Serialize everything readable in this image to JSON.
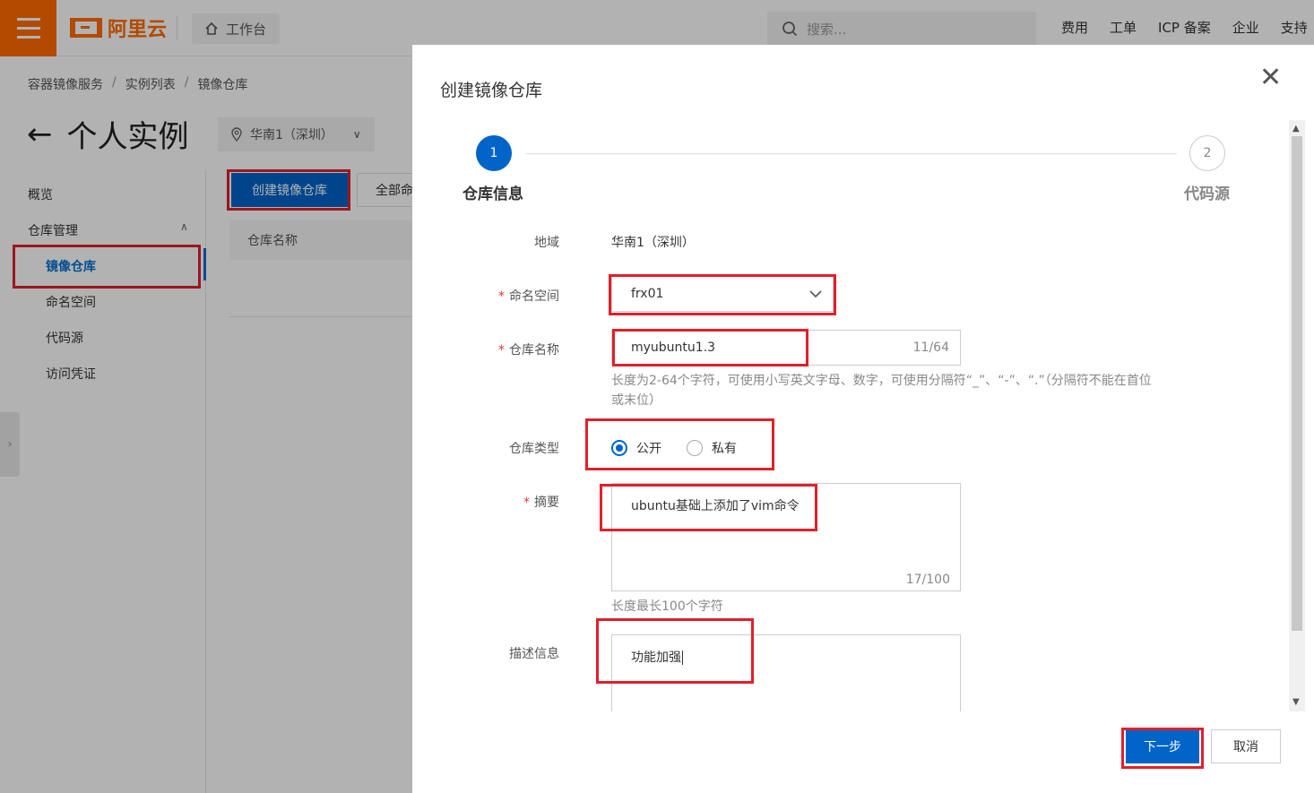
{
  "topbar": {
    "logo_text": "阿里云",
    "workbench_label": "工作台",
    "search_placeholder": "搜索...",
    "nav": [
      "费用",
      "工单",
      "ICP 备案",
      "企业",
      "支持"
    ]
  },
  "breadcrumb": [
    "容器镜像服务",
    "实例列表",
    "镜像仓库"
  ],
  "page": {
    "title": "个人实例",
    "region": "华南1（深圳）"
  },
  "sidebar": {
    "overview": "概览",
    "repo_manage": "仓库管理",
    "items": [
      "镜像仓库",
      "命名空间",
      "代码源",
      "访问凭证"
    ]
  },
  "main": {
    "create_button": "创建镜像仓库",
    "all_button": "全部命",
    "table_header": "仓库名称"
  },
  "dialog": {
    "title": "创建镜像仓库",
    "steps": [
      {
        "num": "1",
        "label": "仓库信息"
      },
      {
        "num": "2",
        "label": "代码源"
      }
    ],
    "region_label": "地域",
    "region_value": "华南1（深圳）",
    "namespace_label": "命名空间",
    "namespace_value": "frx01",
    "repo_name_label": "仓库名称",
    "repo_name_value": "myubuntu1.3",
    "repo_name_count": "11/64",
    "repo_name_hint_1": "长度为2-64个字符，可使用小写英文字母、数字，可使用分隔符“_”、“-”、“.”（分隔符不能在首位",
    "repo_name_hint_2": "或末位）",
    "repo_type_label": "仓库类型",
    "repo_type_public": "公开",
    "repo_type_private": "私有",
    "summary_label": "摘要",
    "summary_value": "ubuntu基础上添加了vim命令",
    "summary_count": "17/100",
    "summary_hint": "长度最长100个字符",
    "desc_label": "描述信息",
    "desc_value": "功能加强",
    "next_button": "下一步",
    "cancel_button": "取消"
  },
  "colors": {
    "brand_orange": "#ff6a00",
    "primary_blue": "#0064c8",
    "highlight_red": "#e0202a"
  }
}
